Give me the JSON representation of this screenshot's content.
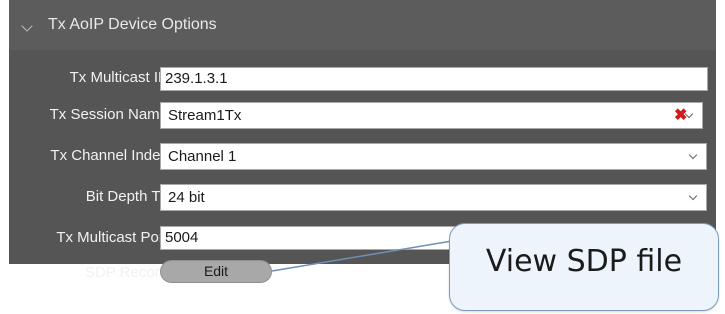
{
  "section": {
    "title": "Tx AoIP Device Options",
    "collapse_icon": "chevron-down-icon"
  },
  "fields": {
    "multicast_ip": {
      "label": "Tx Multicast IP",
      "value": "239.1.3.1"
    },
    "session_name": {
      "label": "Tx Session Name",
      "value": "Stream1Tx"
    },
    "channel_index": {
      "label": "Tx Channel Index",
      "value": "Channel 1"
    },
    "bit_depth": {
      "label": "Bit Depth Tx",
      "value": "24 bit"
    },
    "multicast_port": {
      "label": "Tx Multicast Port",
      "value": "5004"
    },
    "sdp_record": {
      "label": "SDP Record",
      "button_label": "Edit"
    }
  },
  "delete_icon": {
    "glyph": "✖",
    "color": "#d21b1b"
  },
  "callout": {
    "text": "View SDP file"
  },
  "colors": {
    "panel_bg": "#555555",
    "label_text": "#f2f2f2",
    "callout_bg": "#eef4fb",
    "callout_border": "#7d9bbf"
  }
}
